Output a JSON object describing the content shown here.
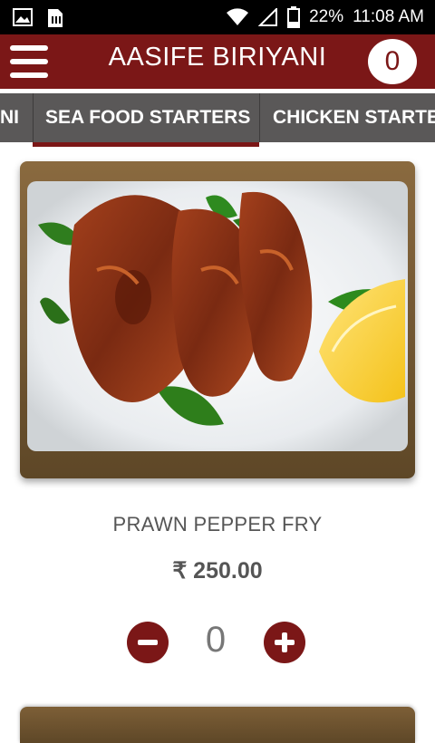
{
  "status_bar": {
    "battery_percent": "22%",
    "time": "11:08 AM",
    "icons": [
      "image-icon",
      "sim-card-icon",
      "wifi-icon",
      "signal-icon",
      "battery-icon"
    ]
  },
  "header": {
    "title": "AASIFE BIRIYANI",
    "cart_count": "0",
    "menu_icon": "hamburger-menu-icon"
  },
  "tabs": [
    {
      "label": "NI",
      "selected": false
    },
    {
      "label": "SEA FOOD STARTERS",
      "selected": true
    },
    {
      "label": "CHICKEN STARTERS",
      "selected": false
    }
  ],
  "product": {
    "name": "PRAWN PEPPER FRY",
    "price": "₹ 250.00",
    "quantity": "0"
  },
  "colors": {
    "brand": "#7b1717",
    "tab_bg": "#5a5858",
    "text_muted": "#555555"
  }
}
